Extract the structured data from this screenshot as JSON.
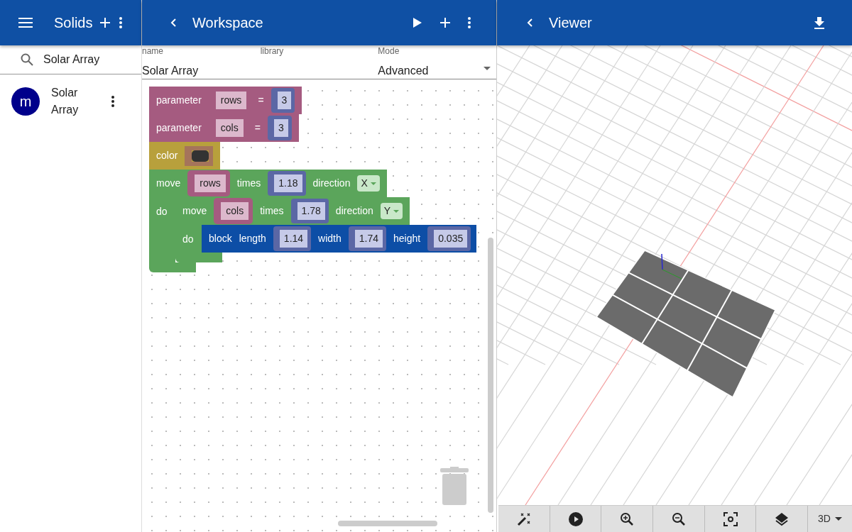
{
  "sidebar": {
    "title": "Solids",
    "search": {
      "value": "Solar Array"
    },
    "items": [
      {
        "avatar": "m",
        "name": "Solar Array"
      }
    ]
  },
  "workspace": {
    "title": "Workspace",
    "fields": [
      {
        "label": "name",
        "value": "Solar Array",
        "kind": "text"
      },
      {
        "label": "library",
        "kind": "text"
      },
      {
        "label": "Mode",
        "value": "Advanced",
        "kind": "select"
      }
    ],
    "blocks": [
      {
        "kind": "parameter",
        "label": "parameter",
        "name": "rows",
        "op": "=",
        "value": "3"
      },
      {
        "kind": "parameter",
        "label": "parameter",
        "name": "cols",
        "op": "=",
        "value": "3"
      },
      {
        "kind": "color",
        "label": "color",
        "color": "#333333"
      },
      {
        "kind": "move",
        "label": "move",
        "var": "rows",
        "times_label": "times",
        "times": "1.18",
        "direction_label": "direction",
        "direction": "X",
        "do_label": "do",
        "children": [
          {
            "kind": "move",
            "label": "move",
            "var": "cols",
            "times_label": "times",
            "times": "1.78",
            "direction_label": "direction",
            "direction": "Y",
            "do_label": "do",
            "children": [
              {
                "kind": "block",
                "label": "block",
                "params": [
                  {
                    "label": "length",
                    "value": "1.14"
                  },
                  {
                    "label": "width",
                    "value": "1.74"
                  },
                  {
                    "label": "height",
                    "value": "0.035"
                  }
                ]
              }
            ]
          }
        ]
      }
    ]
  },
  "viewer": {
    "title": "Viewer",
    "view_mode": "3D"
  }
}
